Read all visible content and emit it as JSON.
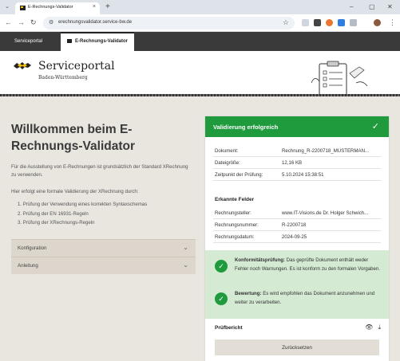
{
  "browser": {
    "tab_title": "E-Rechnungs-Validator",
    "new_tab": "+",
    "url": "erechnungsvalidator.service-bw.de"
  },
  "site_tabs": [
    {
      "label": "Serviceportal"
    },
    {
      "label": "E-Rechnungs-Validator"
    }
  ],
  "header": {
    "brand": "Serviceportal",
    "region": "Baden-Württemberg"
  },
  "main": {
    "title": "Willkommen beim E-Rechnungs-Validator",
    "intro": "Für die Ausstellung von E-Rechnungen ist grundsätzlich der Standard XRechnung zu verwenden.",
    "intro2": "Hier erfolgt eine formale Validierung der XRechnung durch:",
    "steps": [
      "1. Prüfung der Verwendung eines korrekten Syntaxschemas",
      "2. Prüfung der EN 16931-Regeln",
      "3. Prüfung der XRechnungs-Regeln"
    ],
    "accordions": [
      {
        "label": "Konfiguration"
      },
      {
        "label": "Anleitung"
      }
    ]
  },
  "result": {
    "status": "Validierung erfolgreich",
    "details": [
      {
        "key": "Dokument:",
        "value": "Rechnung_R-2200718_MUSTERMAN..."
      },
      {
        "key": "Dateigröße:",
        "value": "12,16 KB"
      },
      {
        "key": "Zeitpunkt der Prüfung:",
        "value": "5.10.2024 15:38:51"
      }
    ],
    "fields_title": "Erkannte Felder",
    "fields": [
      {
        "key": "Rechnungsteller:",
        "value": "www.IT-Visions.de Dr. Holger Schwich..."
      },
      {
        "key": "Rechnungsnummer:",
        "value": "R-2200718"
      },
      {
        "key": "Rechnungsdatum:",
        "value": "2024-09-25"
      }
    ],
    "conformity_label": "Konformitätsprüfung:",
    "conformity_text": " Das geprüfte Dokument enthält weder Fehler noch Warnungen. Es ist konform zu den formalen Vorgaben.",
    "rating_label": "Bewertung:",
    "rating_text": " Es wird empfohlen das Dokument anzunehmen und weiter zu verarbeiten.",
    "report_label": "Prüfbericht",
    "reset_label": "Zurücksetzen"
  },
  "colors": {
    "success": "#1f9a3d",
    "success_bg": "#d5ead3",
    "page_bg": "#e9e6e0",
    "nav_dark": "#3a3a3a"
  },
  "icons": [
    "chevron-down-icon",
    "check-icon",
    "eye-icon",
    "download-icon",
    "clipboard-illustration",
    "lion-logo"
  ]
}
